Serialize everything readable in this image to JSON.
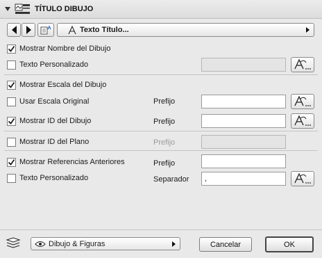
{
  "header": {
    "title": "TÍTULO DIBUJO",
    "collapse_icon": "collapse-triangle-icon",
    "panel_icon": "title-panel-icon"
  },
  "toolbar": {
    "prev_icon": "triangle-left-icon",
    "next_icon": "triangle-right-icon",
    "favorites_icon": "favorites-icon",
    "title_type_icon": "text-title-icon",
    "title_type_value": "Texto Título..."
  },
  "options": [
    {
      "id": "mostrar_nombre",
      "label": "Mostrar Nombre del Dibujo",
      "checked": true
    },
    {
      "id": "texto_personalizado_1",
      "label": "Texto Personalizado",
      "checked": false,
      "field_value": "",
      "field_disabled": true
    },
    {
      "id": "mostrar_escala",
      "label": "Mostrar Escala del Dibujo",
      "checked": true
    },
    {
      "id": "usar_escala_original",
      "label": "Usar Escala Original",
      "checked": false,
      "prefix_label": "Prefijo",
      "field_value": ""
    },
    {
      "id": "mostrar_id_dibujo",
      "label": "Mostrar ID del Dibujo",
      "checked": true,
      "prefix_label": "Prefijo",
      "field_value": ""
    },
    {
      "id": "mostrar_id_plano",
      "label": "Mostrar ID del Plano",
      "checked": false,
      "prefix_label": "Prefijo",
      "field_value": "",
      "field_disabled": true
    },
    {
      "id": "mostrar_referencias",
      "label": "Mostrar Referencias Anteriores",
      "checked": true,
      "prefix_label": "Prefijo",
      "field_value": ""
    },
    {
      "id": "texto_personalizado_2",
      "label": "Texto Personalizado",
      "checked": false,
      "prefix_label": "Separador",
      "field_value": ","
    }
  ],
  "font_button_icon": "text-style-icon",
  "footer": {
    "layers_icon": "layers-icon",
    "view_icon": "eye-icon",
    "layer_value": "Dibujo & Figuras",
    "cancel_label": "Cancelar",
    "ok_label": "OK"
  },
  "colors": {
    "background": "#e9e9e9",
    "check": "#1a1a1a"
  }
}
